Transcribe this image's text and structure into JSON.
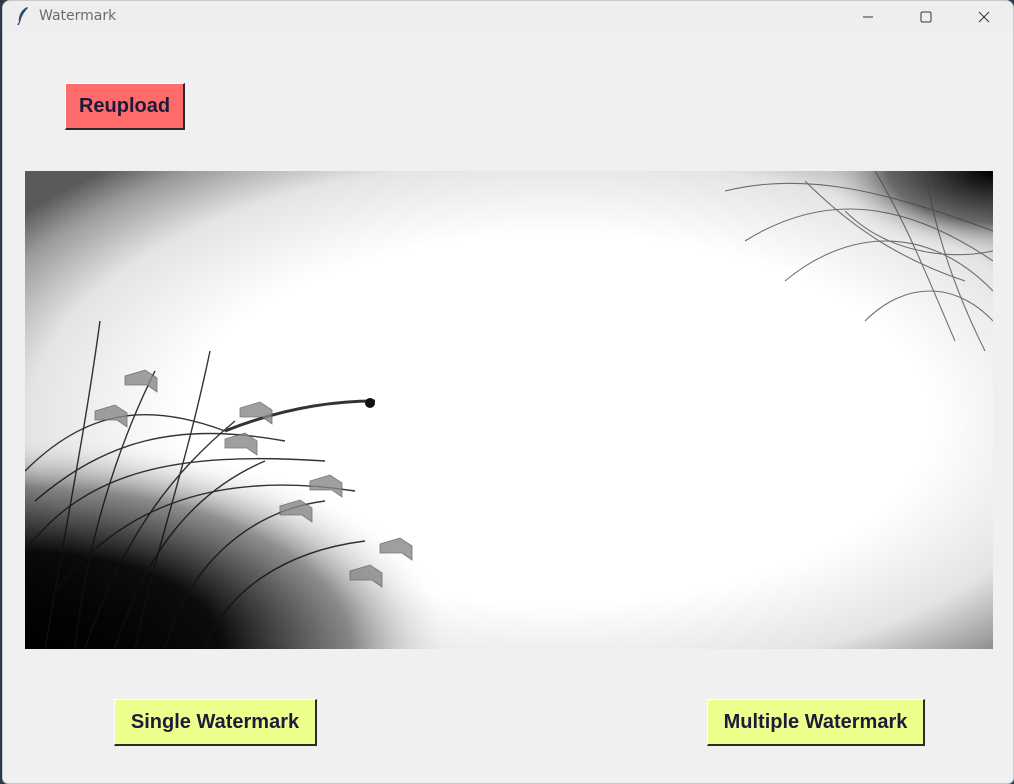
{
  "window": {
    "title": "Watermark",
    "app_icon": "feather-icon"
  },
  "titlebar_controls": {
    "minimize": "minimize-icon",
    "maximize": "maximize-icon",
    "close": "close-icon"
  },
  "buttons": {
    "reupload_label": "Reupload",
    "single_label": "Single Watermark",
    "multiple_label": "Multiple Watermark"
  },
  "colors": {
    "reupload_bg": "#ff6b6b",
    "watermark_btn_bg": "#ecff8c",
    "window_bg": "#f0f0f0"
  },
  "preview": {
    "description_icon": "uploaded-image-preview"
  }
}
